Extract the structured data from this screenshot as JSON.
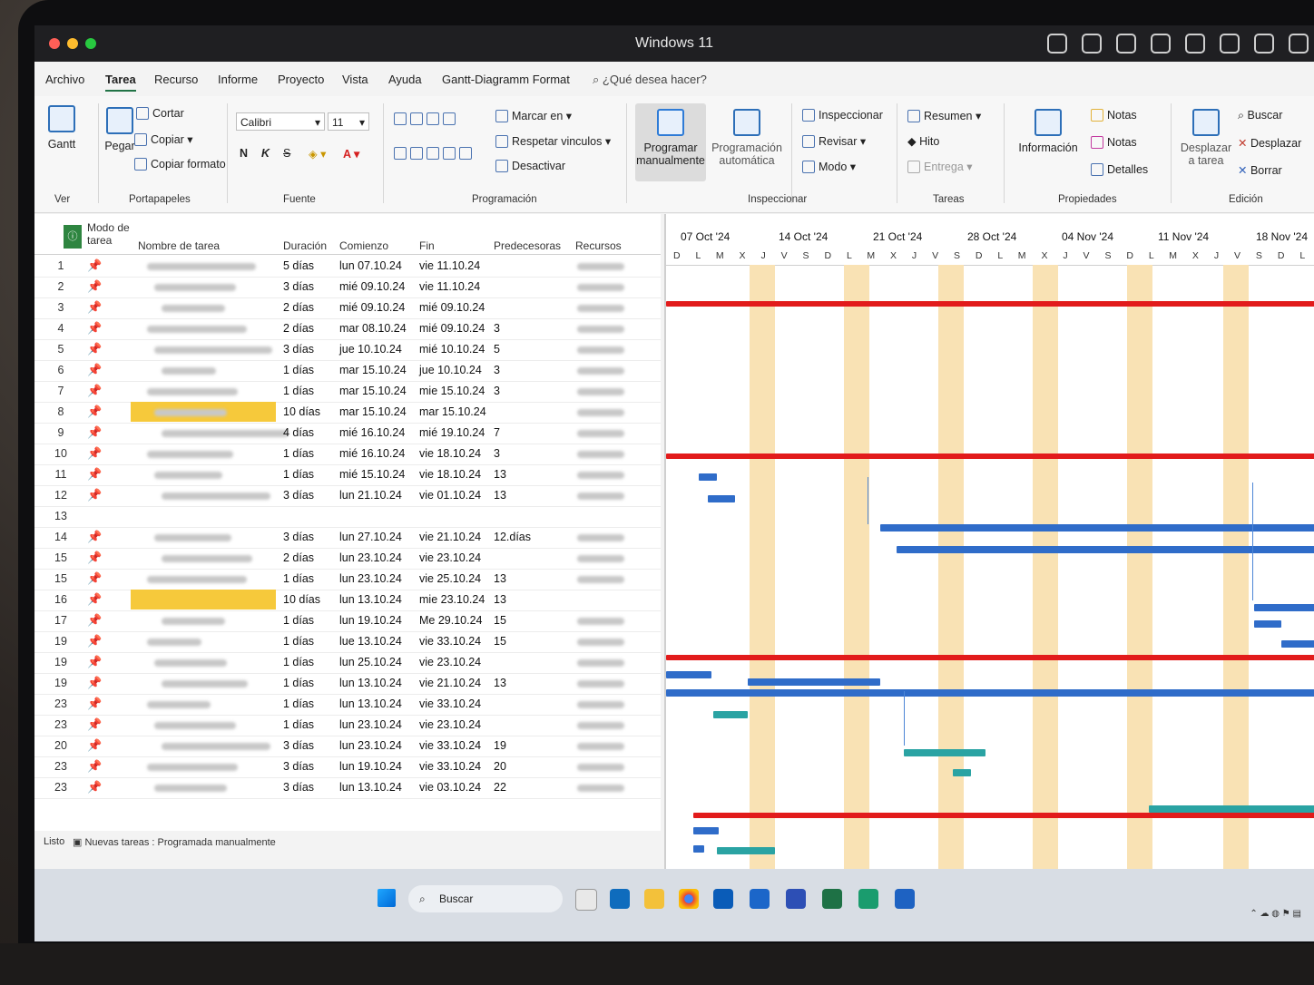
{
  "window": {
    "title": "Windows 11"
  },
  "tabs": [
    "Archivo",
    "Tarea",
    "Recurso",
    "Informe",
    "Proyecto",
    "Vista",
    "Ayuda",
    "Gantt-Diagramm Format"
  ],
  "active_tab": "Tarea",
  "tell_me": "¿Qué desea hacer?",
  "ribbon": {
    "ver": {
      "gantt": "Gantt",
      "label": "Ver"
    },
    "portapapeles": {
      "pegar": "Pegar",
      "cortar": "Cortar",
      "copiar": "Copiar",
      "copiar_formato": "Copiar formato",
      "label": "Portapapeles"
    },
    "fuente": {
      "font": "Calibri",
      "size": "11",
      "bold": "N",
      "italic": "K",
      "strike": "S",
      "label": "Fuente"
    },
    "programacion": {
      "marcar": "Marcar en",
      "respetar": "Respetar vinculos",
      "desactivar": "Desactivar",
      "label": "Programación"
    },
    "tareas_mode": {
      "manual_1": "Programar",
      "manual_2": "manualmente",
      "auto_1": "Programación",
      "auto_2": "automática"
    },
    "inspeccionar": {
      "inspeccionar": "Inspeccionar",
      "revisar": "Revisar",
      "modo": "Modo",
      "label": "Inspeccionar"
    },
    "tareas": {
      "resumen": "Resumen",
      "hito": "Hito",
      "entrega": "Entrega",
      "label": "Tareas"
    },
    "propiedades": {
      "informacion": "Información",
      "notas1": "Notas",
      "notas2": "Notas",
      "detalles": "Detalles",
      "label": "Propiedades"
    },
    "edicion": {
      "desplazar_1": "Desplazar",
      "desplazar_2": "a tarea",
      "buscar": "Buscar",
      "desplazar": "Desplazar",
      "borrar": "Borrar",
      "label": "Edición"
    }
  },
  "table": {
    "headers": {
      "mode": "Modo de tarea",
      "name": "Nombre de tarea",
      "duration": "Duración",
      "start": "Comienzo",
      "end": "Fin",
      "pred": "Predecesoras",
      "res": "Recursos"
    },
    "rows": [
      {
        "n": "1",
        "dur": "5 días",
        "start": "lun 07.10.24",
        "end": "vie 11.10.24",
        "pred": ""
      },
      {
        "n": "2",
        "dur": "3 días",
        "start": "mié 09.10.24",
        "end": "vie 11.10.24",
        "pred": ""
      },
      {
        "n": "3",
        "dur": "2 días",
        "start": "mié 09.10.24",
        "end": "mié 09.10.24",
        "pred": ""
      },
      {
        "n": "4",
        "dur": "2 días",
        "start": "mar 08.10.24",
        "end": "mié 09.10.24",
        "pred": "3"
      },
      {
        "n": "5",
        "dur": "3 días",
        "start": "jue 10.10.24",
        "end": "mié 10.10.24",
        "pred": "5"
      },
      {
        "n": "6",
        "dur": "1 días",
        "start": "mar 15.10.24",
        "end": "jue 10.10.24",
        "pred": "3"
      },
      {
        "n": "7",
        "dur": "1 días",
        "start": "mar 15.10.24",
        "end": "mie 15.10.24",
        "pred": "3"
      },
      {
        "n": "8",
        "dur": "10 días",
        "start": "mar 15.10.24",
        "end": "mar 15.10.24",
        "pred": ""
      },
      {
        "n": "9",
        "dur": "4 días",
        "start": "mié 16.10.24",
        "end": "mié 19.10.24",
        "pred": "7"
      },
      {
        "n": "10",
        "dur": "1 días",
        "start": "mié 16.10.24",
        "end": "vie 18.10.24",
        "pred": "3"
      },
      {
        "n": "11",
        "dur": "1 días",
        "start": "mié 15.10.24",
        "end": "vie 18.10.24",
        "pred": "13"
      },
      {
        "n": "12",
        "dur": "3 días",
        "start": "lun 21.10.24",
        "end": "vie 01.10.24",
        "pred": "13"
      },
      {
        "n": "13",
        "dur": "",
        "start": "",
        "end": "",
        "pred": ""
      },
      {
        "n": "14",
        "dur": "3 días",
        "start": "lun 27.10.24",
        "end": "vie 21.10.24",
        "pred": "12.días"
      },
      {
        "n": "15",
        "dur": "2 días",
        "start": "lun 23.10.24",
        "end": "vie 23.10.24",
        "pred": ""
      },
      {
        "n": "15",
        "dur": "1 días",
        "start": "lun 23.10.24",
        "end": "vie 25.10.24",
        "pred": "13"
      },
      {
        "n": "16",
        "dur": "10 días",
        "start": "lun 13.10.24",
        "end": "mie 23.10.24",
        "pred": "13"
      },
      {
        "n": "17",
        "dur": "1 días",
        "start": "lun 19.10.24",
        "end": "Me 29.10.24",
        "pred": "15"
      },
      {
        "n": "19",
        "dur": "1 días",
        "start": "lue 13.10.24",
        "end": "vie 33.10.24",
        "pred": "15"
      },
      {
        "n": "19",
        "dur": "1 días",
        "start": "lun 25.10.24",
        "end": "vie 23.10.24",
        "pred": ""
      },
      {
        "n": "19",
        "dur": "1 días",
        "start": "lun 13.10.24",
        "end": "vie 21.10.24",
        "pred": "13"
      },
      {
        "n": "23",
        "dur": "1 días",
        "start": "lun 13.10.24",
        "end": "vie 33.10.24",
        "pred": ""
      },
      {
        "n": "23",
        "dur": "1 días",
        "start": "lun 23.10.24",
        "end": "vie 23.10.24",
        "pred": ""
      },
      {
        "n": "20",
        "dur": "3 días",
        "start": "lun 23.10.24",
        "end": "vie 33.10.24",
        "pred": "19"
      },
      {
        "n": "23",
        "dur": "3 días",
        "start": "lun 19.10.24",
        "end": "vie 33.10.24",
        "pred": "20"
      },
      {
        "n": "23",
        "dur": "3 días",
        "start": "lun 13.10.24",
        "end": "vie 03.10.24",
        "pred": "22"
      }
    ]
  },
  "gantt": {
    "weeks": [
      "07 Oct '24",
      "14 Oct '24",
      "21 Oct '24",
      "28 Oct '24",
      "04 Nov '24",
      "11 Nov '24",
      "18 Nov '24"
    ],
    "days": "D L M X J V S D L M X J V S D L M X J V S D L M X J V S D L M X J V S D L M X J V S D L M X J"
  },
  "status": {
    "ready": "Listo",
    "new_tasks": "Nuevas tareas : Programada manualmente"
  },
  "taskbar": {
    "search": "Buscar"
  },
  "colors": {
    "accent": "#217346",
    "summary": "#e21b1b",
    "task": "#2f6cc9",
    "milestone_done": "#2aa3a3",
    "weekend": "#f9e2b4",
    "selected": "#f6c93b"
  }
}
